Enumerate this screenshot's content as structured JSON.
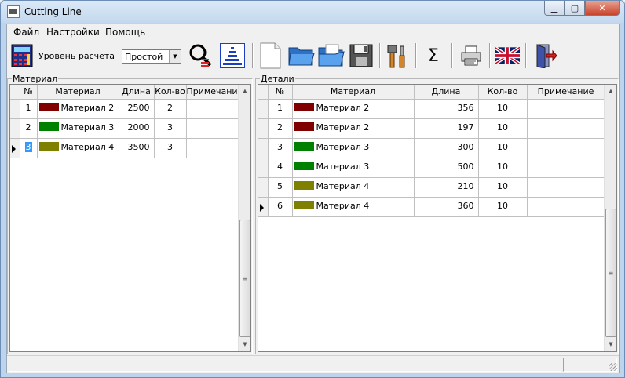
{
  "window": {
    "title": "Cutting Line"
  },
  "menu": [
    {
      "label": "Файл",
      "name": "menu-file"
    },
    {
      "label": "Настройки",
      "name": "menu-settings"
    },
    {
      "label": "Помощь",
      "name": "menu-help"
    }
  ],
  "toolbar": {
    "level_label": "Уровень расчета",
    "level_value": "Простой",
    "icons": [
      "calculator-icon",
      "search-report-icon",
      "pyramid-icon",
      "new-document-icon",
      "open-folder-icon",
      "open-folder-alt-icon",
      "save-disk-icon",
      "tools-icon",
      "sigma-icon",
      "printer-icon",
      "uk-flag-icon",
      "exit-door-icon"
    ]
  },
  "colors": {
    "dark_red": "#800000",
    "green": "#008000",
    "olive": "#808000"
  },
  "left_panel": {
    "caption": "Материал",
    "columns": [
      "№",
      "Материал",
      "Длина",
      "Кол-во",
      "Примечание"
    ],
    "rows": [
      {
        "num": "1",
        "material": "Материал 2",
        "color": "#800000",
        "length": "2500",
        "qty": "2",
        "note": "",
        "current": false
      },
      {
        "num": "2",
        "material": "Материал 3",
        "color": "#008000",
        "length": "2000",
        "qty": "3",
        "note": "",
        "current": false
      },
      {
        "num": "3",
        "material": "Материал 4",
        "color": "#808000",
        "length": "3500",
        "qty": "3",
        "note": "",
        "current": true
      }
    ]
  },
  "right_panel": {
    "caption": "Детали",
    "columns": [
      "№",
      "Материал",
      "Длина",
      "Кол-во",
      "Примечание"
    ],
    "rows": [
      {
        "num": "1",
        "material": "Материал 2",
        "color": "#800000",
        "length": "356",
        "qty": "10",
        "note": "",
        "current": false
      },
      {
        "num": "2",
        "material": "Материал 2",
        "color": "#800000",
        "length": "197",
        "qty": "10",
        "note": "",
        "current": false
      },
      {
        "num": "3",
        "material": "Материал 3",
        "color": "#008000",
        "length": "300",
        "qty": "10",
        "note": "",
        "current": false
      },
      {
        "num": "4",
        "material": "Материал 3",
        "color": "#008000",
        "length": "500",
        "qty": "10",
        "note": "",
        "current": false
      },
      {
        "num": "5",
        "material": "Материал 4",
        "color": "#808000",
        "length": "210",
        "qty": "10",
        "note": "",
        "current": false
      },
      {
        "num": "6",
        "material": "Материал 4",
        "color": "#808000",
        "length": "360",
        "qty": "10",
        "note": "",
        "current": true
      }
    ]
  }
}
